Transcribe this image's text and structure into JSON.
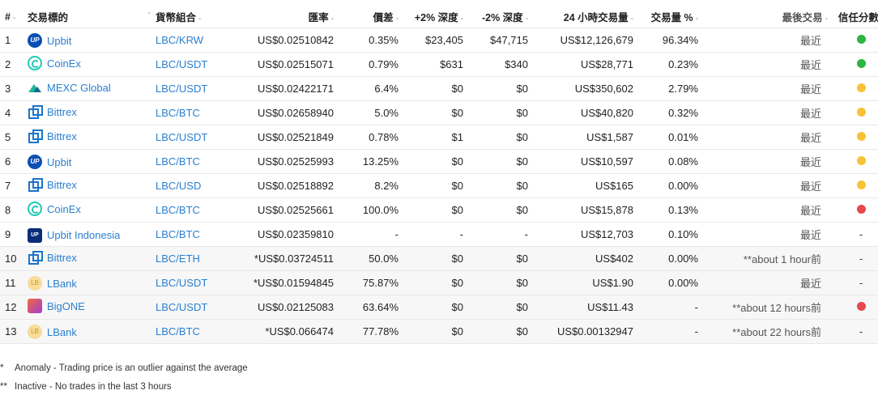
{
  "headers": {
    "num": "#",
    "exchange": "交易標的",
    "pair": "貨幣組合",
    "price": "匯率",
    "spread": "價差",
    "depth_pos": "+2% 深度",
    "depth_neg": "-2% 深度",
    "volume": "24 小時交易量",
    "volume_pct": "交易量 %",
    "last_traded": "最後交易",
    "trust": "信任分數",
    "sort_glyph": "-"
  },
  "colors": {
    "link": "#2a7fd0",
    "green": "#2db640",
    "yellow": "#f8c235",
    "red": "#e5484d"
  },
  "rows": [
    {
      "num": "1",
      "exchange": "Upbit",
      "logo": "upbit",
      "logo_text": "UP",
      "pair": "LBC/KRW",
      "price": "US$0.02510842",
      "spread": "0.35%",
      "depth_pos": "$23,405",
      "depth_neg": "$47,715",
      "volume": "US$12,126,679",
      "volume_pct": "96.34%",
      "updated": "最近",
      "trust": "green",
      "trust_text": ""
    },
    {
      "num": "2",
      "exchange": "CoinEx",
      "logo": "coinex",
      "logo_text": "",
      "pair": "LBC/USDT",
      "price": "US$0.02515071",
      "spread": "0.79%",
      "depth_pos": "$631",
      "depth_neg": "$340",
      "volume": "US$28,771",
      "volume_pct": "0.23%",
      "updated": "最近",
      "trust": "green",
      "trust_text": ""
    },
    {
      "num": "3",
      "exchange": "MEXC Global",
      "logo": "mexc",
      "logo_text": "",
      "pair": "LBC/USDT",
      "price": "US$0.02422171",
      "spread": "6.4%",
      "depth_pos": "$0",
      "depth_neg": "$0",
      "volume": "US$350,602",
      "volume_pct": "2.79%",
      "updated": "最近",
      "trust": "yellow",
      "trust_text": ""
    },
    {
      "num": "4",
      "exchange": "Bittrex",
      "logo": "bittrex",
      "logo_text": "",
      "pair": "LBC/BTC",
      "price": "US$0.02658940",
      "spread": "5.0%",
      "depth_pos": "$0",
      "depth_neg": "$0",
      "volume": "US$40,820",
      "volume_pct": "0.32%",
      "updated": "最近",
      "trust": "yellow",
      "trust_text": ""
    },
    {
      "num": "5",
      "exchange": "Bittrex",
      "logo": "bittrex",
      "logo_text": "",
      "pair": "LBC/USDT",
      "price": "US$0.02521849",
      "spread": "0.78%",
      "depth_pos": "$1",
      "depth_neg": "$0",
      "volume": "US$1,587",
      "volume_pct": "0.01%",
      "updated": "最近",
      "trust": "yellow",
      "trust_text": ""
    },
    {
      "num": "6",
      "exchange": "Upbit",
      "logo": "upbit",
      "logo_text": "UP",
      "pair": "LBC/BTC",
      "price": "US$0.02525993",
      "spread": "13.25%",
      "depth_pos": "$0",
      "depth_neg": "$0",
      "volume": "US$10,597",
      "volume_pct": "0.08%",
      "updated": "最近",
      "trust": "yellow",
      "trust_text": ""
    },
    {
      "num": "7",
      "exchange": "Bittrex",
      "logo": "bittrex",
      "logo_text": "",
      "pair": "LBC/USD",
      "price": "US$0.02518892",
      "spread": "8.2%",
      "depth_pos": "$0",
      "depth_neg": "$0",
      "volume": "US$165",
      "volume_pct": "0.00%",
      "updated": "最近",
      "trust": "yellow",
      "trust_text": ""
    },
    {
      "num": "8",
      "exchange": "CoinEx",
      "logo": "coinex",
      "logo_text": "",
      "pair": "LBC/BTC",
      "price": "US$0.02525661",
      "spread": "100.0%",
      "depth_pos": "$0",
      "depth_neg": "$0",
      "volume": "US$15,878",
      "volume_pct": "0.13%",
      "updated": "最近",
      "trust": "red",
      "trust_text": ""
    },
    {
      "num": "9",
      "exchange": "Upbit Indonesia",
      "logo": "upbitid",
      "logo_text": "UP",
      "pair": "LBC/BTC",
      "price": "US$0.02359810",
      "spread": "-",
      "depth_pos": "-",
      "depth_neg": "-",
      "volume": "US$12,703",
      "volume_pct": "0.10%",
      "updated": "最近",
      "trust": "none",
      "trust_text": "-"
    },
    {
      "num": "10",
      "exchange": "Bittrex",
      "logo": "bittrex",
      "logo_text": "",
      "pair": "LBC/ETH",
      "price": "*US$0.03724511",
      "spread": "50.0%",
      "depth_pos": "$0",
      "depth_neg": "$0",
      "volume": "US$402",
      "volume_pct": "0.00%",
      "updated": "**about 1 hour前",
      "trust": "none",
      "trust_text": "-",
      "inactive": true
    },
    {
      "num": "11",
      "exchange": "LBank",
      "logo": "lbank",
      "logo_text": "LB",
      "pair": "LBC/USDT",
      "price": "*US$0.01594845",
      "spread": "75.87%",
      "depth_pos": "$0",
      "depth_neg": "$0",
      "volume": "US$1.90",
      "volume_pct": "0.00%",
      "updated": "最近",
      "trust": "none",
      "trust_text": "-",
      "inactive": true
    },
    {
      "num": "12",
      "exchange": "BigONE",
      "logo": "bigone",
      "logo_text": "",
      "pair": "LBC/USDT",
      "price": "US$0.02125083",
      "spread": "63.64%",
      "depth_pos": "$0",
      "depth_neg": "$0",
      "volume": "US$11.43",
      "volume_pct": "-",
      "updated": "**about 12 hours前",
      "trust": "red",
      "trust_text": "",
      "inactive": true
    },
    {
      "num": "13",
      "exchange": "LBank",
      "logo": "lbank",
      "logo_text": "LB",
      "pair": "LBC/BTC",
      "price": "*US$0.066474",
      "spread": "77.78%",
      "depth_pos": "$0",
      "depth_neg": "$0",
      "volume": "US$0.00132947",
      "volume_pct": "-",
      "updated": "**about 22 hours前",
      "trust": "none",
      "trust_text": "-",
      "inactive": true
    }
  ],
  "footnotes": [
    {
      "mark": "*",
      "text": "Anomaly - Trading price is an outlier against the average"
    },
    {
      "mark": "**",
      "text": "Inactive - No trades in the last 3 hours"
    }
  ]
}
